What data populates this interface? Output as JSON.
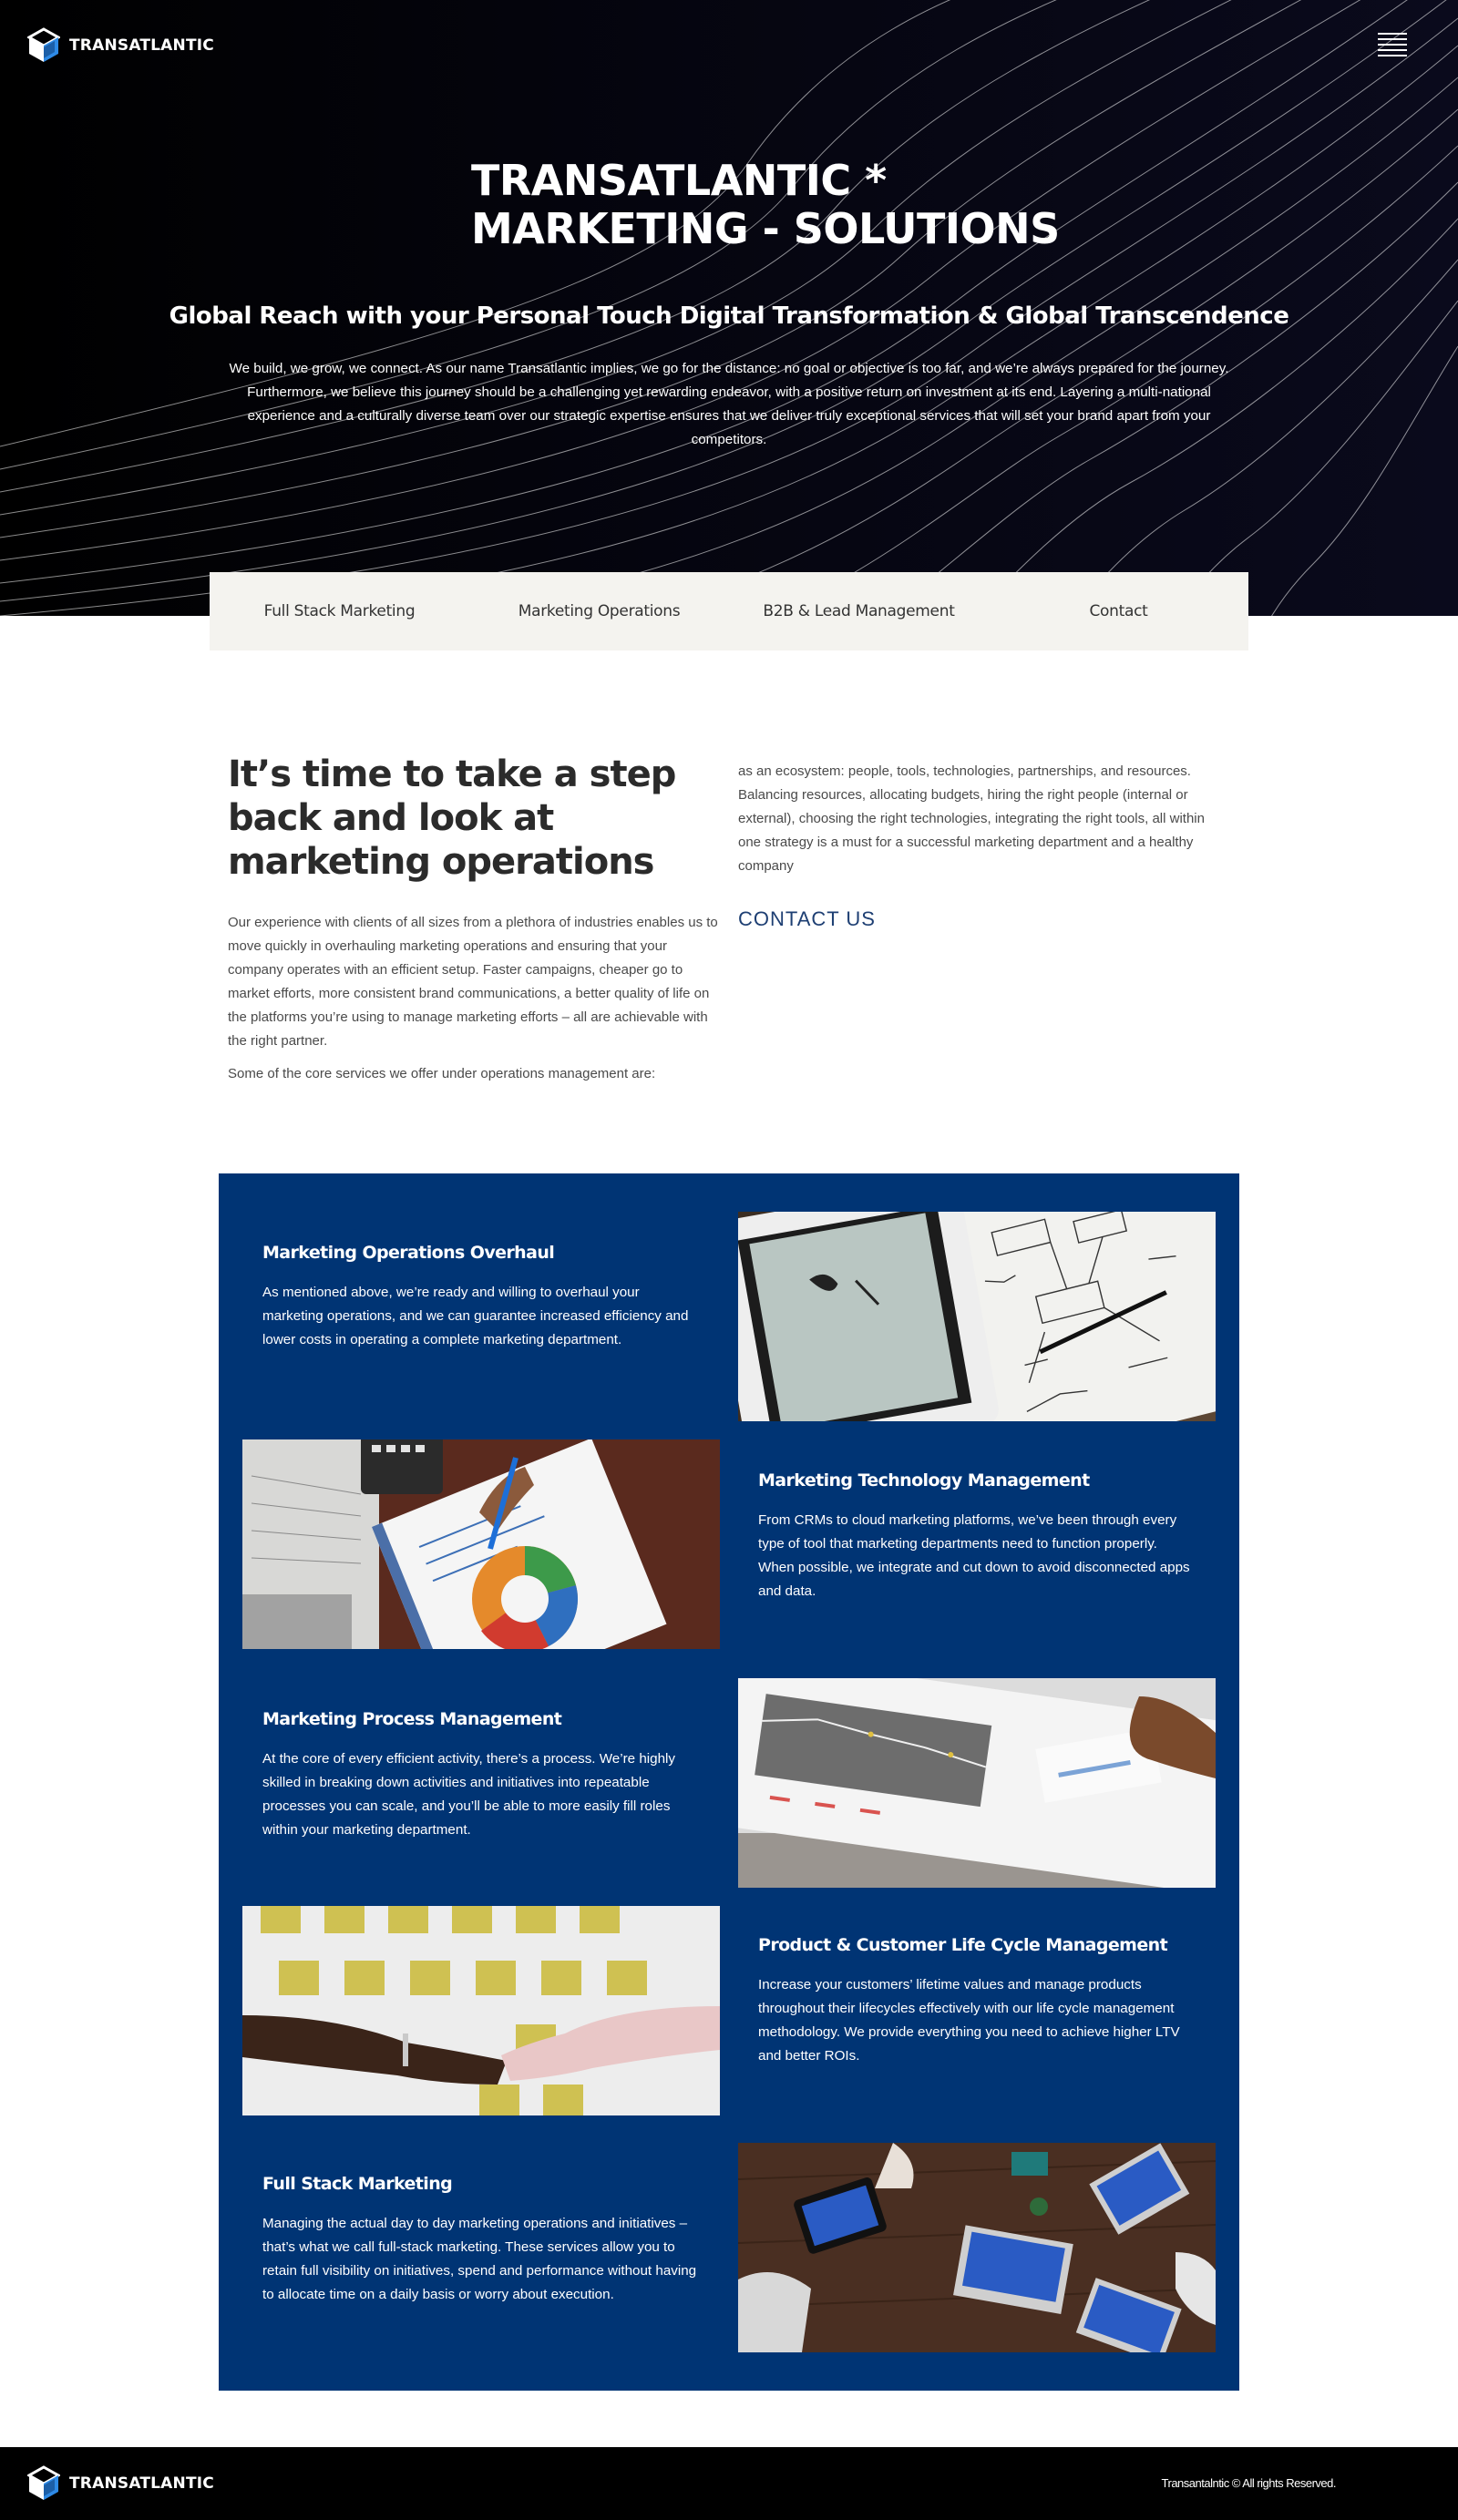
{
  "brand": {
    "name": "TRANSATLANTIC",
    "logo_icon": "cube-logo-icon"
  },
  "header": {
    "menu_icon": "hamburger-menu-icon"
  },
  "hero": {
    "title_line1": "TRANSATLANTIC *",
    "title_line2": "MARKETING - SOLUTIONS",
    "subtitle": "Global Reach with your Personal Touch Digital Transformation & Global Transcendence",
    "body": "We build, we grow, we connect. As our name Transatlantic implies, we go for the distance: no goal or objective is too far, and we’re always prepared for the journey. Furthermore, we believe this journey should be a challenging yet rewarding endeavor, with a positive return on investment at its end. Layering a multi-national experience and a culturally diverse team over our strategic expertise ensures that we deliver truly exceptional services that will set your brand apart from your competitors."
  },
  "nav": {
    "items": [
      {
        "label": "Full Stack Marketing"
      },
      {
        "label": "Marketing Operations"
      },
      {
        "label": "B2B & Lead Management"
      },
      {
        "label": "Contact"
      }
    ]
  },
  "intro": {
    "heading": "It’s time to take a step back and look at marketing operations",
    "paragraph1": "Our experience with clients of all sizes from a plethora of industries enables us to move quickly in overhauling marketing operations and ensuring that your company operates with an efficient setup. Faster campaigns, cheaper go to market efforts, more consistent brand communications, a better quality of life on the platforms you’re using to manage marketing efforts – all are achievable with the right partner.",
    "paragraph2": "Some of the core services we offer under operations management are:",
    "right_text": "as an ecosystem: people, tools, technologies, partnerships, and resources. Balancing resources, allocating budgets, hiring the right people (internal or external), choosing the right technologies, integrating the right tools, all within one strategy is a must for a successful marketing department and a healthy company",
    "contact_label": "CONTACT US"
  },
  "services": [
    {
      "title": "Marketing Operations Overhaul",
      "description": "As mentioned above, we’re ready and willing to overhaul your marketing operations, and we can guarantee increased efficiency and lower costs in operating a complete marketing department."
    },
    {
      "title": "Marketing Technology Management",
      "description": "From CRMs to cloud marketing platforms, we’ve been through every type of tool that marketing departments need to function properly. When possible, we integrate and cut down to avoid disconnected apps and data."
    },
    {
      "title": "Marketing Process Management",
      "description": "At the core of every efficient activity, there’s a process. We’re highly skilled in breaking down activities and initiatives into repeatable processes you can scale, and you’ll be able to more easily fill roles within your marketing department."
    },
    {
      "title": "Product & Customer Life Cycle Management",
      "description": "Increase your customers’ lifetime values and manage products throughout their lifecycles effectively with our life cycle management methodology. We provide everything you need to achieve higher LTV and better ROIs."
    },
    {
      "title": "Full Stack Marketing",
      "description": "Managing the actual day to day marketing operations and initiatives – that’s what we call full-stack marketing. These services allow you to retain full visibility on initiatives, spend and performance without having to allocate time on a daily basis or worry about execution."
    }
  ],
  "footer": {
    "copyright": "Transantalntic © All rights Reserved."
  },
  "colors": {
    "hero_bg": "#000000",
    "services_bg": "#003474",
    "nav_bg": "#f4f3ef",
    "accent_link": "#1e3f73",
    "logo_blue": "#2e8ae6"
  }
}
